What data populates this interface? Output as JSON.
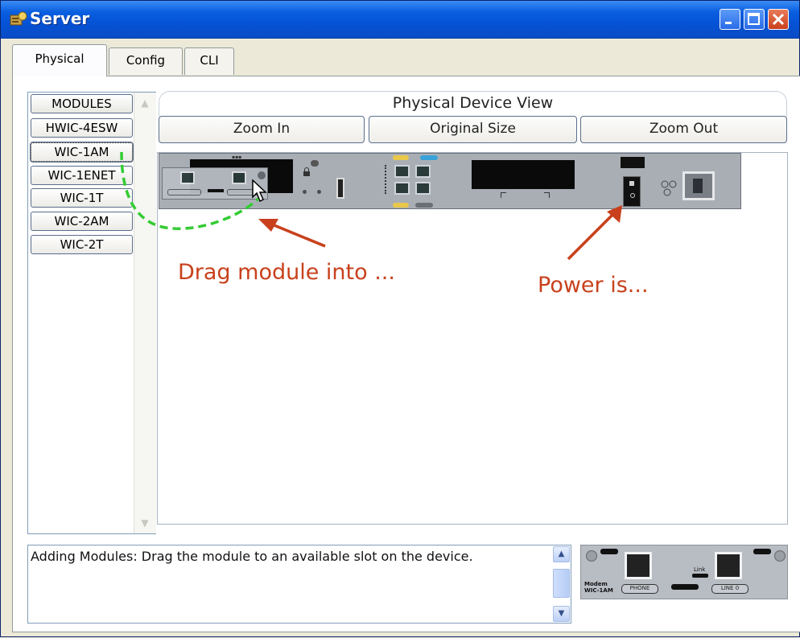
{
  "window": {
    "title": "Server"
  },
  "tabs": [
    {
      "label": "Physical",
      "active": true
    },
    {
      "label": "Config",
      "active": false
    },
    {
      "label": "CLI",
      "active": false
    }
  ],
  "modules": {
    "header": "MODULES",
    "items": [
      "HWIC-4ESW",
      "WIC-1AM",
      "WIC-1ENET",
      "WIC-1T",
      "WIC-2AM",
      "WIC-2T"
    ],
    "selected": "WIC-1AM"
  },
  "physical_view": {
    "title": "Physical Device View",
    "zoom_in": "Zoom In",
    "original_size": "Original Size",
    "zoom_out": "Zoom Out"
  },
  "annotations": {
    "drag": "Drag module into ...",
    "power": "Power is..."
  },
  "info": {
    "text": "Adding Modules: Drag the module to an available slot on the device."
  },
  "module_preview": {
    "name_line1": "Modem",
    "name_line2": "WIC-1AM",
    "phone_label": "PHONE",
    "line_label": "LINE 0",
    "link_label": "Link"
  },
  "colors": {
    "titlebar": "#0552d6",
    "annotation": "#c8411c",
    "drag_path": "#33cc33"
  }
}
